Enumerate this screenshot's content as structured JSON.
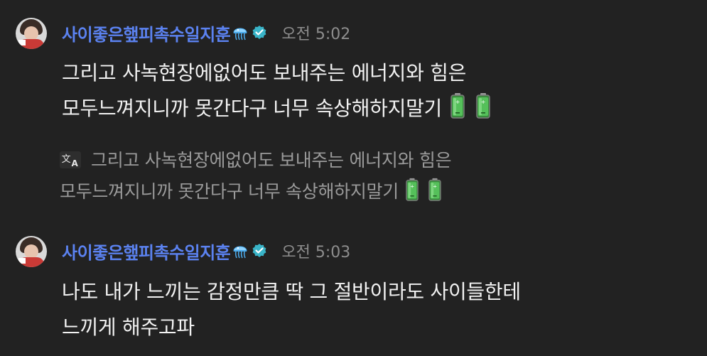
{
  "messages": [
    {
      "author": "사이좋은햎피촉수일지훈",
      "time": "오전 5:02",
      "lines": [
        "그리고 사녹현장에없어도 보내주는 에너지와 힘은",
        "모두느껴지니까 못간다구 너무 속상해하지말기"
      ],
      "translation": [
        "그리고 사녹현장에없어도 보내주는 에너지와 힘은",
        "모두느껴지니까 못간다구 너무 속상해하지말기"
      ]
    },
    {
      "author": "사이좋은햎피촉수일지훈",
      "time": "오전 5:03",
      "lines": [
        "나도 내가 느끼는 감정만큼 딱 그 절반이라도 사이들한테",
        "느끼게 해주고파"
      ]
    }
  ],
  "icons": {
    "author_emoji": "jellyfish-icon",
    "verified": "verified-badge-icon",
    "translate": "translate-icon",
    "battery": "battery-icon"
  },
  "colors": {
    "background": "#222222",
    "author_name": "#5b82f0",
    "timestamp": "#8d8d8d",
    "message_text": "#f2f2f2",
    "translation_text": "#9a9a9a",
    "verified_badge": "#39b4c8",
    "battery": "#4caf50"
  }
}
